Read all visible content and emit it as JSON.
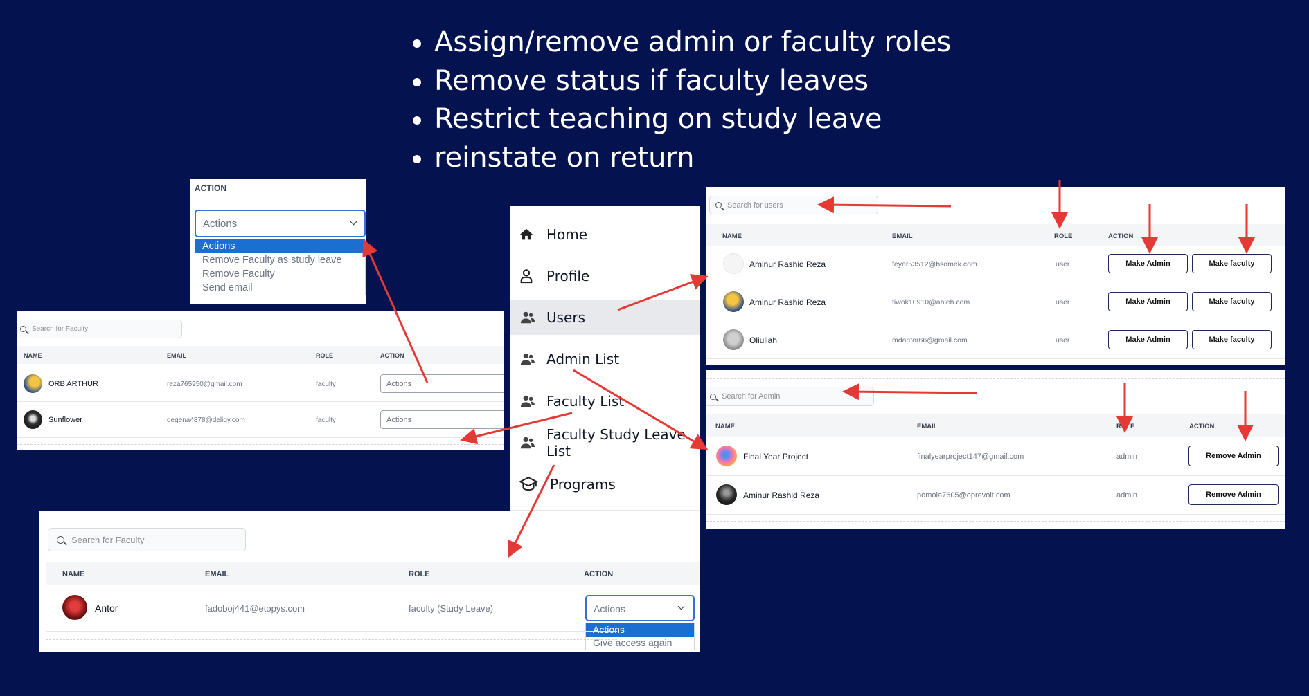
{
  "bullets": [
    "Assign/remove admin or faculty roles",
    "Remove status if faculty leaves",
    "Restrict teaching on study leave",
    "reinstate on return"
  ],
  "action_dropdown_panel": {
    "header": "ACTION",
    "select_value": "Actions",
    "options": [
      "Actions",
      "Remove Faculty as study leave",
      "Remove Faculty",
      "Send email"
    ]
  },
  "faculty_list_panel": {
    "search_placeholder": "Search for Faculty",
    "headers": {
      "name": "NAME",
      "email": "EMAIL",
      "role": "ROLE",
      "action": "ACTION"
    },
    "rows": [
      {
        "name": "ORB ARTHUR",
        "email": "reza765950@gmail.com",
        "role": "faculty",
        "action": "Actions"
      },
      {
        "name": "Sunflower",
        "email": "degena4878@deligy.com",
        "role": "faculty",
        "action": "Actions"
      }
    ]
  },
  "sidebar": {
    "items": [
      {
        "label": "Home",
        "icon": "home-icon"
      },
      {
        "label": "Profile",
        "icon": "user-icon"
      },
      {
        "label": "Users",
        "icon": "users-icon",
        "active": true
      },
      {
        "label": "Admin List",
        "icon": "users-icon"
      },
      {
        "label": "Faculty List",
        "icon": "users-icon"
      },
      {
        "label": "Faculty Study Leave List",
        "icon": "users-icon"
      },
      {
        "label": "Programs",
        "icon": "graduation-cap-icon"
      }
    ]
  },
  "users_panel": {
    "search_placeholder": "Search for users",
    "headers": {
      "name": "NAME",
      "email": "EMAIL",
      "role": "ROLE",
      "action": "ACTION"
    },
    "make_admin_label": "Make Admin",
    "make_faculty_label": "Make faculty",
    "rows": [
      {
        "name": "Aminur Rashid Reza",
        "email": "feyer53512@bsomek.com",
        "role": "user"
      },
      {
        "name": "Aminur Rashid Reza",
        "email": "tiwok10910@ahieh.com",
        "role": "user"
      },
      {
        "name": "Oliullah",
        "email": "mdantor66@gmail.com",
        "role": "user"
      }
    ]
  },
  "admin_panel": {
    "search_placeholder": "Search for Admin",
    "headers": {
      "name": "NAME",
      "email": "EMAIL",
      "role": "ROLE",
      "action": "ACTION"
    },
    "remove_admin_label": "Remove Admin",
    "rows": [
      {
        "name": "Final Year Project",
        "email": "finalyearproject147@gmail.com",
        "role": "admin"
      },
      {
        "name": "Aminur Rashid Reza",
        "email": "pomola7605@oprevolt.com",
        "role": "admin"
      }
    ]
  },
  "study_leave_panel": {
    "search_placeholder": "Search for Faculty",
    "headers": {
      "name": "NAME",
      "email": "EMAIL",
      "role": "ROLE",
      "action": "ACTION"
    },
    "rows": [
      {
        "name": "Antor",
        "email": "fadoboj441@etopys.com",
        "role": "faculty (Study Leave)"
      }
    ],
    "select_value": "Actions",
    "options": [
      "Actions",
      "Give access again"
    ]
  },
  "colors": {
    "background": "#04134f",
    "arrow": "#e53935",
    "selected_option": "#1a6fd1"
  }
}
